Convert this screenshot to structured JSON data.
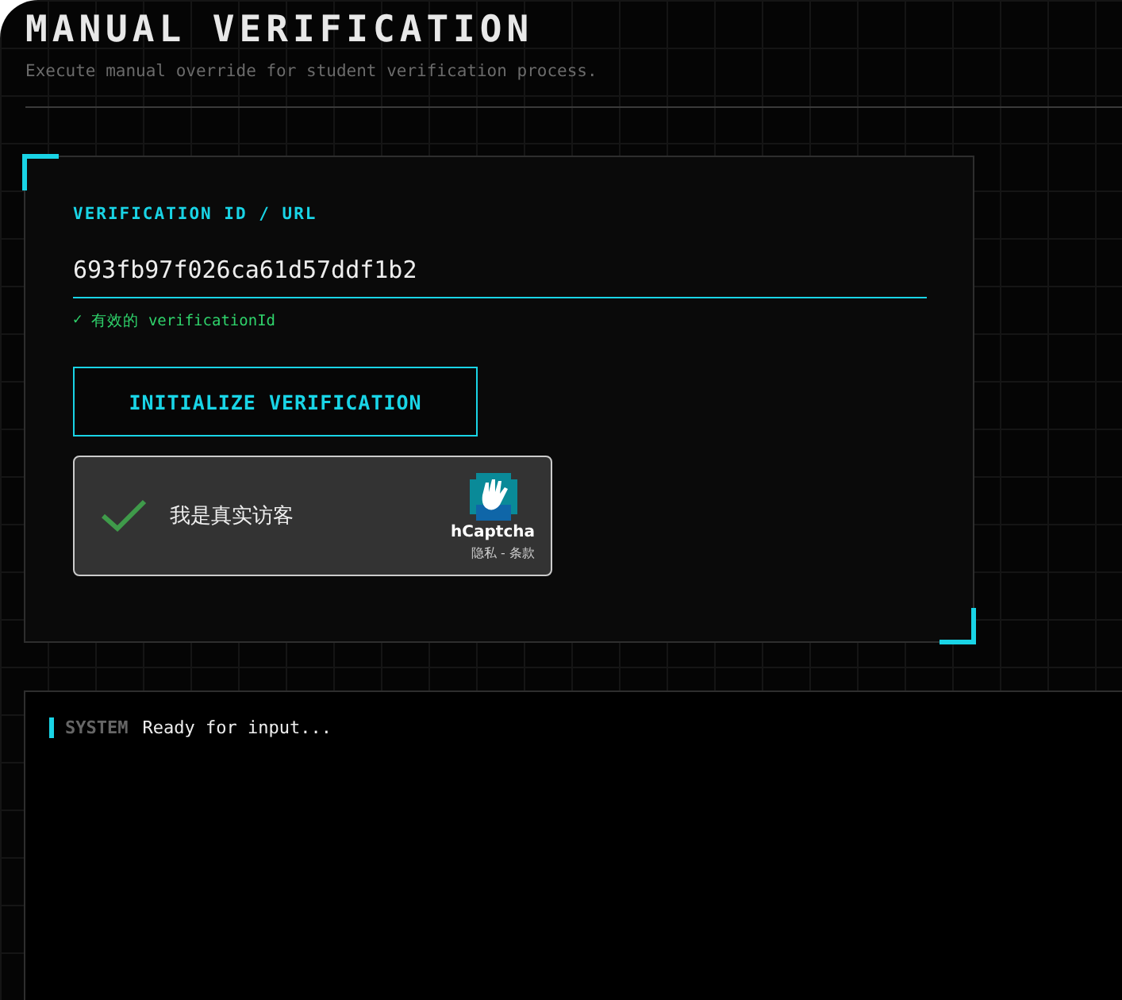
{
  "header": {
    "title": "MANUAL VERIFICATION",
    "subtitle": "Execute manual override for student verification process."
  },
  "form": {
    "label": "VERIFICATION ID / URL",
    "value": "693fb97f026ca61d57ddf1b2",
    "validation": {
      "valid": true,
      "icon": "✓",
      "message": "有效的 verificationId"
    },
    "button": "INITIALIZE VERIFICATION",
    "captcha": {
      "checked": true,
      "label": "我是真实访客",
      "brand": "hCaptcha",
      "links": "隐私 - 条款"
    }
  },
  "log": [
    {
      "source": "SYSTEM",
      "message": "Ready for input..."
    }
  ]
}
